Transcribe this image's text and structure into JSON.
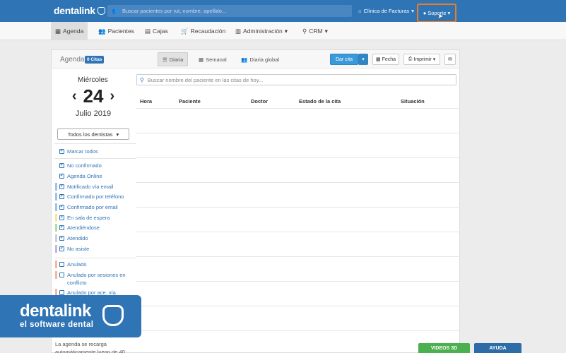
{
  "topbar": {
    "logo": "dentalink",
    "search_placeholder": "Buscar pacientes por rut, nombre, apellido...",
    "clinic": "Clínica de Facturas",
    "support": "Soporte"
  },
  "nav": [
    {
      "label": "Agenda"
    },
    {
      "label": "Pacientes"
    },
    {
      "label": "Cajas"
    },
    {
      "label": "Recaudación"
    },
    {
      "label": "Administración"
    },
    {
      "label": "CRM"
    }
  ],
  "panel": {
    "title": "Agenda",
    "badge": "0 Citas",
    "tabs": [
      {
        "label": "Diaria"
      },
      {
        "label": "Semanal"
      },
      {
        "label": "Diaria global"
      }
    ],
    "buttons": {
      "new": "Dar cita",
      "date": "Fecha",
      "print": "Imprimir"
    }
  },
  "date": {
    "weekday": "Miércoles",
    "day": "24",
    "month_year": "Julio 2019"
  },
  "dentist_select": "Todos los dentistas",
  "checks": [
    {
      "label": "Marcar todos",
      "checked": true,
      "color": ""
    },
    {
      "label": "No confirmado",
      "checked": true,
      "color": ""
    },
    {
      "label": "Agenda Online",
      "checked": true,
      "color": ""
    },
    {
      "label": "Notificado vía email",
      "checked": true,
      "color": "#9ec3e6"
    },
    {
      "label": "Confirmado por teléfono",
      "checked": true,
      "color": "#9ec3e6"
    },
    {
      "label": "Confirmado por email",
      "checked": true,
      "color": "#9ec3e6"
    },
    {
      "label": "En sala de espera",
      "checked": true,
      "color": "#f5e79e"
    },
    {
      "label": "Atendiéndose",
      "checked": true,
      "color": "#a8e0a8"
    },
    {
      "label": "Atendido",
      "checked": true,
      "color": "#cfcfcf"
    },
    {
      "label": "No asiste",
      "checked": true,
      "color": "#c8b4e0"
    },
    {
      "label": "Anulado",
      "checked": false,
      "color": "#f4b89c"
    },
    {
      "label": "Anulado por sesiones en conflicto",
      "checked": false,
      "color": "#f4b89c"
    },
    {
      "label": "Anulado por ace. vía",
      "checked": false,
      "color": "#f4b89c"
    }
  ],
  "table": {
    "search_placeholder": "Buscar nombre del paciente en las citas de hoy...",
    "columns": [
      "Hora",
      "Paciente",
      "Doctor",
      "Estado de la cita",
      "Situación"
    ]
  },
  "brand": {
    "name": "dentalink",
    "subtitle": "el software dental"
  },
  "footnote": "La agenda se recarga automáticamente luego de 40",
  "footer_buttons": {
    "video": "VIDEOS 3D",
    "help": "AYUDA"
  },
  "icons": {
    "check": "✔"
  }
}
